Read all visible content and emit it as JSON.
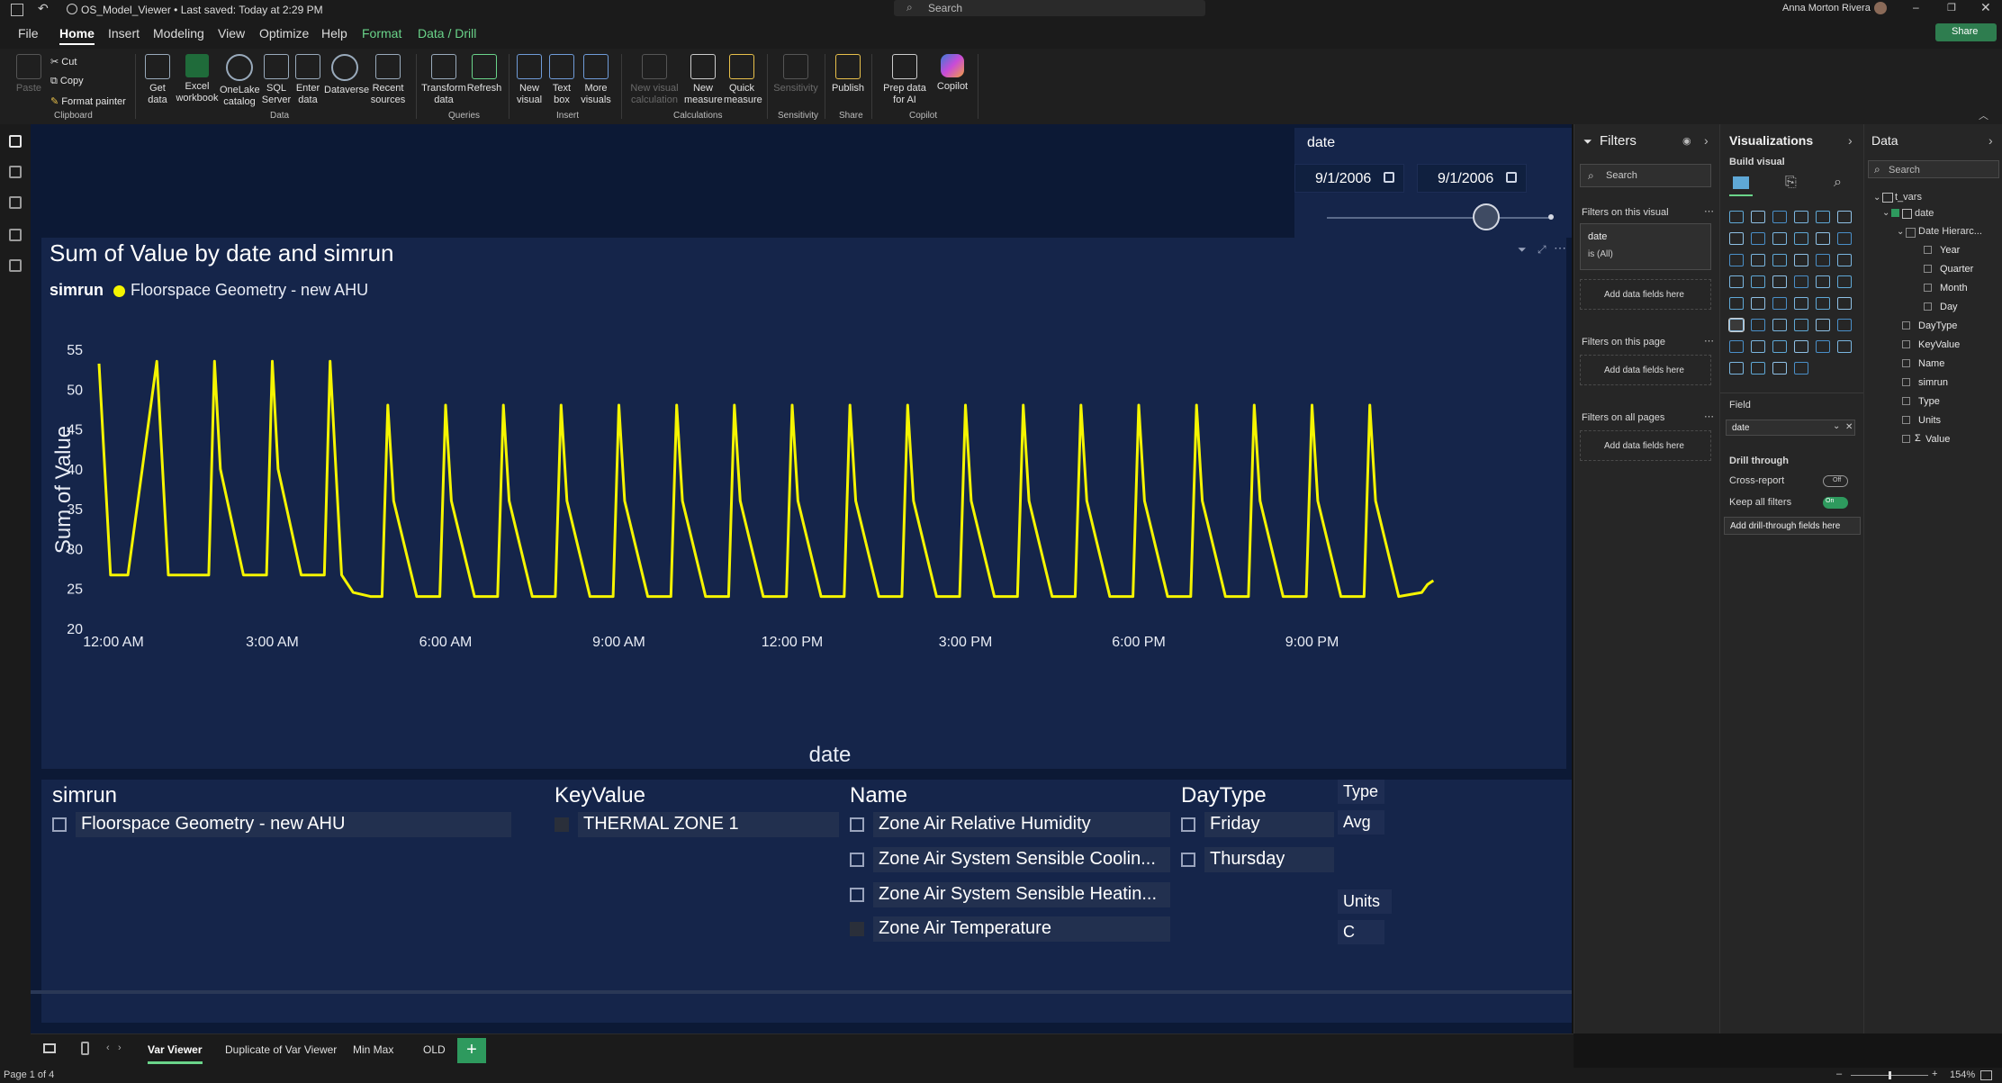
{
  "titlebar": {
    "doc_title": "OS_Model_Viewer • Last saved: Today at 2:29 PM",
    "search_placeholder": "Search",
    "user_name": "Anna Morton Rivera",
    "share_label": "Share"
  },
  "menu": {
    "items": [
      "File",
      "Home",
      "Insert",
      "Modeling",
      "View",
      "Optimize",
      "Help",
      "Format",
      "Data / Drill"
    ]
  },
  "ribbon": {
    "clipboard": {
      "paste": "Paste",
      "cut": "Cut",
      "copy": "Copy",
      "format_painter": "Format painter",
      "group": "Clipboard"
    },
    "data": {
      "get_data": "Get data",
      "excel": "Excel workbook",
      "onelake": "OneLake catalog",
      "sql": "SQL Server",
      "enter": "Enter data",
      "dataverse": "Dataverse",
      "recent": "Recent sources",
      "group": "Data"
    },
    "queries": {
      "transform": "Transform data",
      "refresh": "Refresh",
      "group": "Queries"
    },
    "insert": {
      "new_visual": "New visual",
      "text_box": "Text box",
      "more_visuals": "More visuals",
      "group": "Insert"
    },
    "calculations": {
      "new_visual_calc": "New visual calculation",
      "new_measure": "New measure",
      "quick_measure": "Quick measure",
      "group": "Calculations"
    },
    "sensitivity": {
      "label": "Sensitivity",
      "group": "Sensitivity"
    },
    "share": {
      "publish": "Publish",
      "group": "Share"
    },
    "copilot": {
      "prep": "Prep data for AI",
      "copilot": "Copilot",
      "group": "Copilot"
    }
  },
  "date_slicer": {
    "title": "date",
    "start": "9/1/2006",
    "end": "9/1/2006"
  },
  "chart_title": "Sum of Value by date and simrun",
  "legend": {
    "title": "simrun",
    "series": "Floorspace Geometry - new AHU"
  },
  "chart_data": {
    "type": "line",
    "title": "Sum of Value by date and simrun",
    "xlabel": "date",
    "ylabel": "Sum of Value",
    "ylim": [
      20,
      55
    ],
    "yticks": [
      "20",
      "25",
      "30",
      "35",
      "40",
      "45",
      "50",
      "55"
    ],
    "xticks": [
      "12:00 AM",
      "3:00 AM",
      "6:00 AM",
      "9:00 AM",
      "12:00 PM",
      "3:00 PM",
      "6:00 PM",
      "9:00 PM"
    ],
    "xrange_hours": [
      0,
      24
    ],
    "grid": false,
    "legend_position": "top-left",
    "series": [
      {
        "name": "Floorspace Geometry - new AHU",
        "color": "#f5f500",
        "x_hours": [
          0.0,
          0.1,
          0.2,
          0.3,
          0.5,
          1.0,
          1.1,
          1.2,
          1.5,
          1.9,
          2.0,
          2.1,
          2.5,
          2.9,
          3.0,
          3.1,
          3.5,
          3.9,
          4.0,
          4.1,
          4.2,
          4.4,
          4.7,
          4.9,
          5.0,
          5.1,
          5.5,
          5.9,
          6.0,
          6.1,
          6.5,
          6.9,
          7.0,
          7.1,
          7.5,
          7.9,
          8.0,
          8.1,
          8.5,
          8.9,
          9.0,
          9.1,
          9.5,
          9.9,
          10.0,
          10.1,
          10.5,
          10.9,
          11.0,
          11.1,
          11.5,
          11.9,
          12.0,
          12.1,
          12.5,
          12.9,
          13.0,
          13.1,
          13.5,
          13.9,
          14.0,
          14.1,
          14.5,
          14.9,
          15.0,
          15.1,
          15.5,
          15.9,
          16.0,
          16.1,
          16.5,
          16.9,
          17.0,
          17.1,
          17.5,
          17.9,
          18.0,
          18.1,
          18.5,
          18.9,
          19.0,
          19.1,
          19.5,
          19.9,
          20.0,
          20.1,
          20.5,
          20.9,
          21.0,
          21.1,
          21.5,
          21.9,
          22.0,
          22.1,
          22.5,
          22.9,
          23.0,
          23.1,
          23.5,
          23.7
        ],
        "values": [
          53.2,
          40,
          26.7,
          26.7,
          26.7,
          53.5,
          40,
          26.7,
          26.7,
          26.7,
          53.5,
          40,
          26.7,
          26.7,
          53.5,
          40,
          26.7,
          26.7,
          53.5,
          40,
          26.7,
          24.5,
          24.0,
          24.0,
          48.0,
          36,
          24.0,
          24.0,
          48.0,
          36,
          24.0,
          24.0,
          48.0,
          36,
          24.0,
          24.0,
          48.0,
          36,
          24.0,
          24.0,
          48.0,
          36,
          24.0,
          24.0,
          48.0,
          36,
          24.0,
          24.0,
          48.0,
          36,
          24.0,
          24.0,
          48.0,
          36,
          24.0,
          24.0,
          48.0,
          36,
          24.0,
          24.0,
          48.0,
          36,
          24.0,
          24.0,
          48.0,
          36,
          24.0,
          24.0,
          48.0,
          36,
          24.0,
          24.0,
          48.0,
          36,
          24.0,
          24.0,
          48.0,
          36,
          24.0,
          24.0,
          48.0,
          36,
          24.0,
          24.0,
          48.0,
          36,
          24.0,
          24.0,
          48.0,
          36,
          24.0,
          24.0,
          48.0,
          36,
          24.0,
          24.5,
          25.5,
          26.0
        ]
      }
    ]
  },
  "slicers": {
    "simrun": {
      "header": "simrun",
      "items": [
        "Floorspace Geometry - new AHU"
      ]
    },
    "keyvalue": {
      "header": "KeyValue",
      "items": [
        "THERMAL ZONE 1"
      ]
    },
    "name": {
      "header": "Name",
      "items": [
        "Zone Air Relative Humidity",
        "Zone Air System Sensible Coolin...",
        "Zone Air System Sensible Heatin...",
        "Zone Air Temperature"
      ]
    },
    "daytype": {
      "header": "DayType",
      "items": [
        "Friday",
        "Thursday"
      ]
    },
    "type": {
      "header": "Type",
      "value": "Avg"
    },
    "units": {
      "header": "Units",
      "value": "C"
    }
  },
  "filters_pane": {
    "title": "Filters",
    "search_placeholder": "Search",
    "on_visual": "Filters on this visual",
    "card_field": "date",
    "card_value": "is (All)",
    "add1": "Add data fields here",
    "on_page": "Filters on this page",
    "add2": "Add data fields here",
    "all_pages": "Filters on all pages",
    "add3": "Add data fields here"
  },
  "viz_pane": {
    "title": "Visualizations",
    "build": "Build visual",
    "field_label": "Field",
    "field_value": "date",
    "drill_through": "Drill through",
    "cross_report": "Cross-report",
    "cross_state": "Off",
    "keep_filters": "Keep all filters",
    "keep_state": "On",
    "add_drill": "Add drill-through fields here"
  },
  "data_pane": {
    "title": "Data",
    "search_placeholder": "Search",
    "table": "t_vars",
    "date_field": "date",
    "hierarchy": "Date Hierarc...",
    "levels": [
      "Year",
      "Quarter",
      "Month",
      "Day"
    ],
    "fields": [
      "DayType",
      "KeyValue",
      "Name",
      "simrun",
      "Type",
      "Units",
      "Value"
    ]
  },
  "tabs": [
    "Var Viewer",
    "Duplicate of Var Viewer",
    "Min Max",
    "OLD"
  ],
  "status": {
    "page": "Page 1 of 4",
    "zoom": "154%"
  },
  "colors": {
    "accent_green": "#6ad48a",
    "line_yellow": "#f5f500",
    "report_bg": "#0c1935",
    "visual_bg": "#15254a"
  }
}
